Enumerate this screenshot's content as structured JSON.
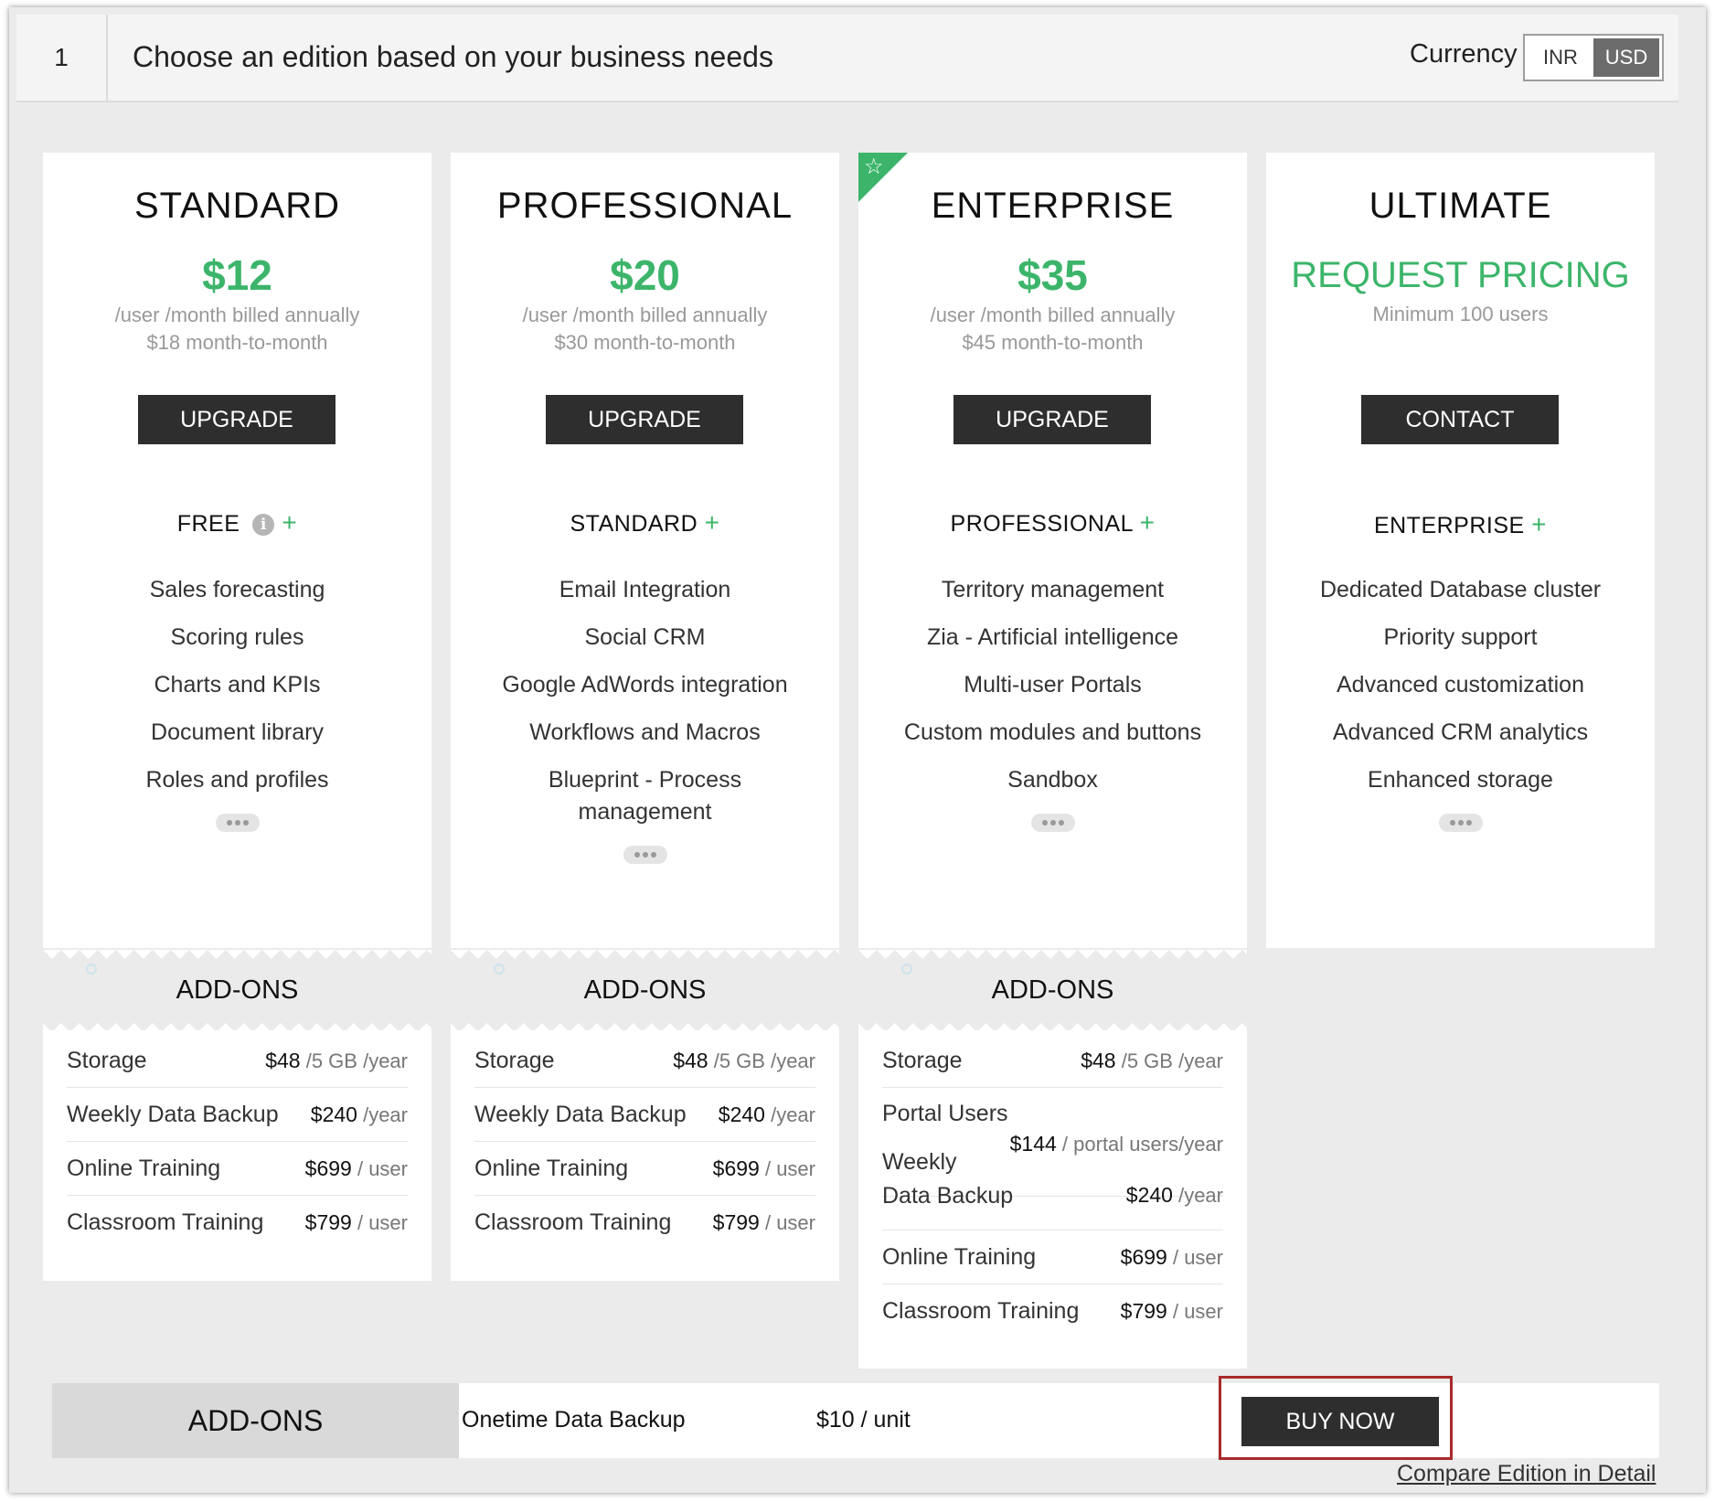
{
  "header": {
    "step_number": "1",
    "title": "Choose an edition based on your business needs",
    "currency_label": "Currency",
    "currency_options": [
      "INR",
      "USD"
    ],
    "currency_selected": "USD"
  },
  "plans": [
    {
      "name": "STANDARD",
      "price": "$12",
      "note_line1": "/user /month billed annually",
      "note_line2": "$18 month-to-month",
      "button": "UPGRADE",
      "includes": "FREE",
      "features": [
        "Sales forecasting",
        "Scoring rules",
        "Charts and KPIs",
        "Document library",
        "Roles and profiles"
      ]
    },
    {
      "name": "PROFESSIONAL",
      "price": "$20",
      "note_line1": "/user /month billed annually",
      "note_line2": "$30 month-to-month",
      "button": "UPGRADE",
      "includes": "STANDARD",
      "features": [
        "Email Integration",
        "Social CRM",
        "Google AdWords integration",
        "Workflows and Macros",
        "Blueprint - Process management"
      ]
    },
    {
      "name": "ENTERPRISE",
      "price": "$35",
      "note_line1": "/user /month billed annually",
      "note_line2": "$45 month-to-month",
      "button": "UPGRADE",
      "includes": "PROFESSIONAL",
      "features": [
        "Territory management",
        "Zia - Artificial intelligence",
        "Multi-user Portals",
        "Custom modules and buttons",
        "Sandbox"
      ]
    },
    {
      "name": "ULTIMATE",
      "request_pricing": "REQUEST PRICING",
      "min_users": "Minimum 100 users",
      "button": "CONTACT",
      "includes": "ENTERPRISE",
      "features": [
        "Dedicated Database cluster",
        "Priority support",
        "Advanced customization",
        "Advanced CRM analytics",
        "Enhanced storage"
      ]
    }
  ],
  "addons_title": "ADD-ONS",
  "addons": {
    "standard": [
      {
        "name": "Storage",
        "amount": "$48",
        "unit": "/5 GB /year"
      },
      {
        "name": "Weekly Data Backup",
        "amount": "$240",
        "unit": "/year"
      },
      {
        "name": "Online Training",
        "amount": "$699",
        "unit": "/ user"
      },
      {
        "name": "Classroom Training",
        "amount": "$799",
        "unit": "/ user"
      }
    ],
    "professional": [
      {
        "name": "Storage",
        "amount": "$48",
        "unit": "/5 GB /year"
      },
      {
        "name": "Weekly Data Backup",
        "amount": "$240",
        "unit": "/year"
      },
      {
        "name": "Online Training",
        "amount": "$699",
        "unit": "/ user"
      },
      {
        "name": "Classroom Training",
        "amount": "$799",
        "unit": "/ user"
      }
    ],
    "enterprise": {
      "storage": {
        "name": "Storage",
        "amount": "$48",
        "unit": "/5 GB /year"
      },
      "portal": {
        "name": "Portal Users",
        "amount": "$144",
        "unit": "/ portal users/year"
      },
      "backup": {
        "name_line1": "Weekly",
        "name_line2": "Data Backup",
        "amount": "$240",
        "unit": "/year"
      },
      "online": {
        "name": "Online Training",
        "amount": "$699",
        "unit": "/ user"
      },
      "classroom": {
        "name": "Classroom Training",
        "amount": "$799",
        "unit": "/ user"
      }
    }
  },
  "bottom": {
    "label": "ADD-ONS",
    "item_name": "Onetime Data Backup",
    "item_price": "$10 / unit",
    "buy_button": "BUY NOW",
    "compare_link": "Compare Edition in Detail"
  },
  "colors": {
    "accent_green": "#3cb56a",
    "button_dark": "#2e2e2e",
    "highlight_red": "#a82a2a"
  }
}
